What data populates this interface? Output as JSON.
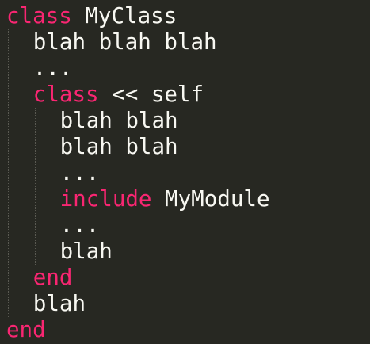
{
  "colors": {
    "background": "#272822",
    "keyword": "#f92672",
    "text": "#f8f8f2",
    "indent_guide": "#5a5a52"
  },
  "code": {
    "lines": [
      {
        "indent": 0,
        "tokens": [
          {
            "type": "keyword",
            "text": "class"
          },
          {
            "type": "text",
            "text": " MyClass"
          }
        ]
      },
      {
        "indent": 1,
        "tokens": [
          {
            "type": "text",
            "text": "blah blah blah"
          }
        ]
      },
      {
        "indent": 1,
        "tokens": [
          {
            "type": "text",
            "text": "..."
          }
        ]
      },
      {
        "indent": 1,
        "tokens": [
          {
            "type": "keyword",
            "text": "class"
          },
          {
            "type": "text",
            "text": " << self"
          }
        ]
      },
      {
        "indent": 2,
        "tokens": [
          {
            "type": "text",
            "text": "blah blah"
          }
        ]
      },
      {
        "indent": 2,
        "tokens": [
          {
            "type": "text",
            "text": "blah blah"
          }
        ]
      },
      {
        "indent": 2,
        "tokens": [
          {
            "type": "text",
            "text": "..."
          }
        ]
      },
      {
        "indent": 2,
        "tokens": [
          {
            "type": "keyword",
            "text": "include"
          },
          {
            "type": "text",
            "text": " MyModule"
          }
        ]
      },
      {
        "indent": 2,
        "tokens": [
          {
            "type": "text",
            "text": "..."
          }
        ]
      },
      {
        "indent": 2,
        "tokens": [
          {
            "type": "text",
            "text": "blah"
          }
        ]
      },
      {
        "indent": 1,
        "tokens": [
          {
            "type": "keyword",
            "text": "end"
          }
        ]
      },
      {
        "indent": 1,
        "tokens": [
          {
            "type": "text",
            "text": "blah"
          }
        ]
      },
      {
        "indent": 0,
        "tokens": [
          {
            "type": "keyword",
            "text": "end"
          }
        ]
      }
    ]
  }
}
